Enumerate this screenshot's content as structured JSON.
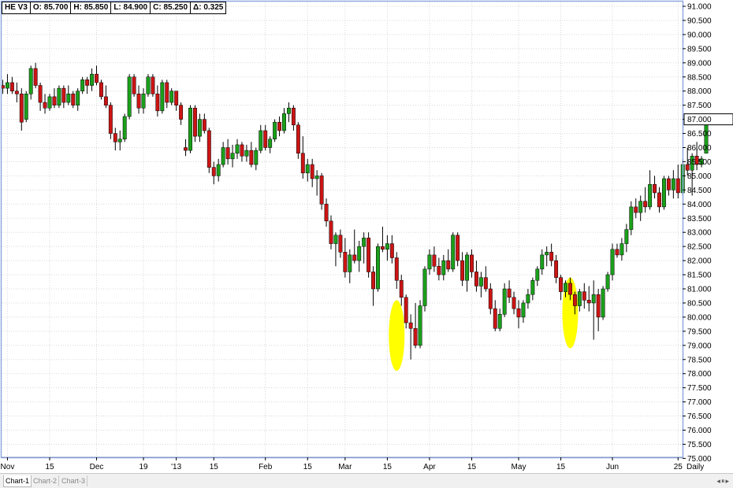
{
  "header": {
    "symbol": "HE V3",
    "open": "O: 85.700",
    "high": "H: 85.850",
    "low": "L: 84.900",
    "close": "C: 85.250",
    "change": "Δ: 0.325"
  },
  "tabs": [
    "Chart-1",
    "Chart-2",
    "Chart-3"
  ],
  "nav_icons": [
    "arrow-left-icon",
    "pause-icon",
    "arrow-right-icon"
  ],
  "colors": {
    "up": "#1aa01a",
    "down": "#cc1414",
    "highlight": "#ffff00",
    "frame": "#8fa8e0",
    "last_price_box": "#ffffff"
  },
  "chart_data": {
    "type": "candlestick",
    "period_label": "Daily",
    "ylim": [
      75.0,
      91.0
    ],
    "y_ticks": [
      "91.000",
      "90.500",
      "90.000",
      "89.500",
      "89.000",
      "88.500",
      "88.000",
      "87.500",
      "87.000",
      "86.500",
      "86.000",
      "85.500",
      "85.000",
      "84.500",
      "84.000",
      "83.500",
      "83.000",
      "82.500",
      "82.000",
      "81.500",
      "81.000",
      "80.500",
      "80.000",
      "79.500",
      "79.000",
      "78.500",
      "78.000",
      "77.500",
      "77.000",
      "76.500",
      "76.000",
      "75.500",
      "75.000"
    ],
    "last_price_label": "87.000",
    "x_ticks": [
      {
        "label": "Nov",
        "i": 1
      },
      {
        "label": "15",
        "i": 10
      },
      {
        "label": "Dec",
        "i": 20
      },
      {
        "label": "19",
        "i": 30
      },
      {
        "label": "'13",
        "i": 37
      },
      {
        "label": "15",
        "i": 45
      },
      {
        "label": "Feb",
        "i": 56
      },
      {
        "label": "15",
        "i": 65
      },
      {
        "label": "Mar",
        "i": 73
      },
      {
        "label": "15",
        "i": 82
      },
      {
        "label": "Apr",
        "i": 91
      },
      {
        "label": "15",
        "i": 100
      },
      {
        "label": "May",
        "i": 110
      },
      {
        "label": "15",
        "i": 119
      },
      {
        "label": "Jun",
        "i": 130
      },
      {
        "label": "25",
        "i": 144
      }
    ],
    "highlights": [
      {
        "i": 84,
        "center": 79.35,
        "half_height": 1.25
      },
      {
        "i": 121,
        "center": 80.15,
        "half_height": 1.25
      }
    ],
    "ohlc": [
      [
        88.2,
        88.4,
        87.9,
        88.1
      ],
      [
        88.1,
        88.6,
        87.9,
        88.3
      ],
      [
        88.3,
        88.5,
        87.9,
        88.0
      ],
      [
        88.0,
        88.3,
        87.6,
        87.9
      ],
      [
        87.9,
        88.1,
        86.6,
        86.9
      ],
      [
        87.0,
        88.0,
        86.9,
        87.9
      ],
      [
        87.9,
        88.9,
        87.7,
        88.8
      ],
      [
        88.8,
        89.0,
        88.1,
        88.2
      ],
      [
        88.2,
        88.3,
        87.3,
        87.6
      ],
      [
        87.6,
        87.9,
        87.2,
        87.4
      ],
      [
        87.4,
        87.9,
        87.3,
        87.8
      ],
      [
        87.8,
        88.1,
        87.4,
        87.5
      ],
      [
        87.5,
        88.2,
        87.4,
        88.1
      ],
      [
        88.1,
        88.2,
        87.4,
        87.6
      ],
      [
        87.6,
        88.2,
        87.5,
        87.9
      ],
      [
        87.9,
        88.0,
        87.4,
        87.5
      ],
      [
        87.5,
        88.1,
        87.3,
        88.0
      ],
      [
        88.0,
        88.5,
        87.9,
        88.4
      ],
      [
        88.4,
        88.5,
        87.9,
        88.2
      ],
      [
        88.2,
        88.8,
        88.0,
        88.6
      ],
      [
        88.6,
        88.9,
        88.2,
        88.3
      ],
      [
        88.3,
        88.4,
        87.7,
        87.8
      ],
      [
        87.8,
        88.2,
        87.4,
        87.5
      ],
      [
        87.5,
        87.6,
        86.3,
        86.5
      ],
      [
        86.5,
        86.7,
        85.9,
        86.2
      ],
      [
        86.2,
        86.6,
        85.9,
        86.3
      ],
      [
        86.3,
        87.2,
        86.2,
        87.1
      ],
      [
        87.1,
        88.6,
        87.0,
        88.5
      ],
      [
        88.5,
        88.6,
        87.8,
        87.9
      ],
      [
        87.9,
        88.2,
        87.2,
        87.4
      ],
      [
        87.4,
        88.1,
        87.2,
        87.9
      ],
      [
        87.9,
        88.6,
        87.8,
        88.5
      ],
      [
        88.5,
        88.6,
        87.8,
        87.9
      ],
      [
        87.9,
        88.2,
        87.1,
        87.3
      ],
      [
        87.3,
        88.4,
        87.2,
        88.3
      ],
      [
        88.3,
        88.4,
        87.4,
        87.6
      ],
      [
        87.6,
        88.1,
        87.5,
        88.0
      ],
      [
        88.0,
        88.0,
        87.3,
        87.5
      ],
      [
        87.5,
        87.6,
        86.8,
        87.0
      ],
      [
        86.0,
        86.3,
        85.7,
        85.9
      ],
      [
        85.9,
        87.5,
        85.8,
        87.4
      ],
      [
        87.4,
        87.5,
        86.2,
        86.4
      ],
      [
        86.4,
        87.2,
        86.2,
        87.0
      ],
      [
        87.0,
        87.2,
        86.5,
        86.6
      ],
      [
        86.6,
        86.7,
        85.1,
        85.3
      ],
      [
        85.3,
        85.5,
        84.7,
        85.0
      ],
      [
        85.0,
        85.6,
        84.8,
        85.4
      ],
      [
        85.4,
        86.2,
        85.3,
        86.0
      ],
      [
        86.0,
        86.3,
        85.4,
        85.6
      ],
      [
        85.6,
        86.1,
        85.3,
        85.8
      ],
      [
        85.8,
        86.3,
        85.6,
        86.1
      ],
      [
        86.1,
        86.2,
        85.5,
        85.7
      ],
      [
        85.7,
        86.1,
        85.5,
        85.9
      ],
      [
        85.9,
        86.2,
        85.3,
        85.4
      ],
      [
        85.4,
        86.0,
        85.2,
        85.9
      ],
      [
        85.9,
        86.8,
        85.8,
        86.6
      ],
      [
        86.6,
        86.8,
        85.9,
        86.0
      ],
      [
        86.0,
        86.4,
        85.8,
        86.3
      ],
      [
        86.3,
        87.0,
        86.2,
        86.9
      ],
      [
        86.9,
        87.1,
        86.4,
        86.6
      ],
      [
        86.6,
        87.4,
        86.5,
        87.2
      ],
      [
        87.2,
        87.6,
        86.9,
        87.4
      ],
      [
        87.4,
        87.5,
        86.6,
        86.8
      ],
      [
        86.8,
        86.9,
        85.6,
        85.8
      ],
      [
        85.8,
        86.4,
        84.9,
        85.1
      ],
      [
        85.1,
        85.6,
        84.8,
        85.4
      ],
      [
        85.4,
        85.6,
        84.6,
        84.9
      ],
      [
        84.9,
        85.2,
        84.3,
        85.0
      ],
      [
        85.0,
        85.1,
        83.8,
        84.0
      ],
      [
        84.0,
        84.2,
        83.2,
        83.4
      ],
      [
        83.4,
        83.6,
        82.4,
        82.6
      ],
      [
        82.6,
        83.0,
        81.8,
        82.9
      ],
      [
        82.9,
        83.1,
        82.1,
        82.3
      ],
      [
        82.3,
        82.8,
        81.4,
        81.6
      ],
      [
        81.6,
        82.4,
        81.2,
        82.2
      ],
      [
        82.2,
        83.1,
        81.9,
        82.0
      ],
      [
        82.0,
        82.7,
        81.6,
        82.5
      ],
      [
        82.5,
        83.0,
        81.9,
        82.8
      ],
      [
        82.8,
        83.0,
        81.4,
        81.6
      ],
      [
        81.6,
        81.8,
        80.4,
        81.0
      ],
      [
        81.0,
        82.6,
        80.9,
        82.5
      ],
      [
        82.5,
        83.2,
        82.3,
        82.4
      ],
      [
        82.4,
        82.9,
        82.0,
        82.6
      ],
      [
        82.6,
        82.9,
        81.9,
        82.1
      ],
      [
        82.1,
        82.3,
        81.0,
        81.3
      ],
      [
        81.3,
        81.5,
        80.4,
        80.7
      ],
      [
        80.7,
        80.8,
        79.6,
        79.8
      ],
      [
        79.8,
        80.1,
        78.5,
        79.6
      ],
      [
        79.6,
        80.5,
        78.9,
        79.0
      ],
      [
        79.0,
        80.6,
        78.9,
        80.4
      ],
      [
        80.4,
        81.8,
        80.2,
        81.7
      ],
      [
        81.7,
        82.4,
        81.5,
        82.2
      ],
      [
        82.2,
        82.5,
        81.6,
        81.8
      ],
      [
        81.8,
        82.1,
        81.3,
        81.5
      ],
      [
        81.5,
        82.2,
        81.3,
        82.0
      ],
      [
        82.0,
        82.4,
        81.6,
        81.7
      ],
      [
        81.7,
        83.0,
        81.6,
        82.9
      ],
      [
        82.9,
        83.0,
        81.8,
        82.0
      ],
      [
        82.0,
        82.3,
        81.1,
        81.3
      ],
      [
        81.3,
        82.3,
        80.9,
        82.2
      ],
      [
        82.2,
        82.4,
        81.4,
        81.6
      ],
      [
        81.6,
        82.0,
        80.9,
        81.1
      ],
      [
        81.1,
        81.6,
        80.7,
        81.4
      ],
      [
        81.4,
        81.8,
        80.9,
        81.0
      ],
      [
        81.0,
        81.2,
        80.1,
        80.3
      ],
      [
        80.3,
        80.6,
        79.5,
        79.6
      ],
      [
        79.6,
        80.3,
        79.5,
        80.1
      ],
      [
        80.1,
        81.2,
        80.0,
        81.0
      ],
      [
        81.0,
        81.3,
        80.5,
        80.7
      ],
      [
        80.7,
        80.9,
        80.1,
        80.3
      ],
      [
        80.3,
        80.6,
        79.6,
        80.0
      ],
      [
        80.0,
        80.6,
        79.8,
        80.5
      ],
      [
        80.5,
        81.0,
        80.3,
        80.8
      ],
      [
        80.8,
        81.4,
        80.6,
        81.3
      ],
      [
        81.3,
        81.8,
        81.1,
        81.7
      ],
      [
        81.7,
        82.4,
        81.5,
        82.2
      ],
      [
        82.2,
        82.5,
        81.8,
        82.3
      ],
      [
        82.3,
        82.6,
        81.8,
        82.0
      ],
      [
        82.0,
        82.2,
        81.2,
        81.4
      ],
      [
        81.4,
        81.5,
        80.6,
        80.9
      ],
      [
        80.9,
        81.3,
        80.7,
        81.2
      ],
      [
        81.2,
        81.4,
        80.6,
        80.8
      ],
      [
        80.8,
        80.9,
        80.1,
        80.4
      ],
      [
        80.4,
        81.0,
        80.2,
        80.9
      ],
      [
        80.9,
        81.2,
        80.3,
        80.6
      ],
      [
        80.6,
        81.1,
        80.2,
        80.5
      ],
      [
        80.5,
        81.3,
        79.2,
        80.8
      ],
      [
        80.8,
        81.0,
        79.5,
        80.0
      ],
      [
        80.0,
        81.1,
        79.9,
        81.0
      ],
      [
        81.0,
        81.6,
        80.9,
        81.5
      ],
      [
        81.5,
        82.6,
        81.3,
        82.4
      ],
      [
        82.4,
        82.6,
        82.1,
        82.2
      ],
      [
        82.2,
        82.8,
        82.0,
        82.6
      ],
      [
        82.6,
        83.3,
        82.3,
        83.1
      ],
      [
        83.1,
        84.1,
        82.9,
        83.9
      ],
      [
        83.9,
        84.2,
        83.5,
        83.7
      ],
      [
        83.7,
        84.3,
        83.4,
        84.1
      ],
      [
        84.1,
        84.6,
        83.7,
        83.9
      ],
      [
        83.9,
        85.2,
        83.8,
        84.7
      ],
      [
        84.7,
        85.0,
        84.2,
        84.4
      ],
      [
        84.4,
        84.6,
        83.7,
        83.9
      ],
      [
        83.9,
        85.0,
        83.8,
        84.9
      ],
      [
        84.9,
        85.0,
        84.3,
        84.5
      ],
      [
        84.5,
        85.2,
        84.2,
        84.9
      ],
      [
        84.9,
        85.4,
        84.2,
        84.4
      ],
      [
        84.4,
        85.6,
        84.3,
        85.4
      ],
      [
        85.4,
        86.0,
        85.0,
        85.2
      ],
      [
        85.2,
        85.8,
        84.3,
        85.7
      ],
      [
        85.7,
        86.2,
        85.2,
        85.4
      ],
      [
        85.4,
        85.7,
        85.3,
        85.6
      ],
      [
        85.8,
        87.0,
        85.8,
        87.0
      ]
    ]
  }
}
